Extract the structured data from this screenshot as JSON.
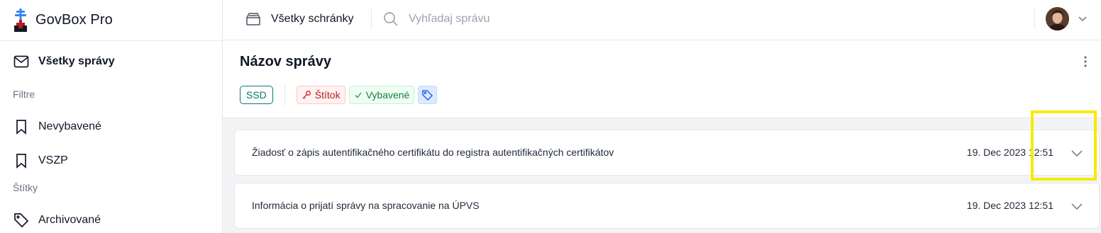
{
  "app": {
    "name": "GovBox Pro"
  },
  "sidebar": {
    "all_messages": "Všetky správy",
    "filters_heading": "Filtre",
    "filters": [
      {
        "label": "Nevybavené",
        "icon": "bookmark-icon"
      },
      {
        "label": "VSZP",
        "icon": "bookmark-icon"
      }
    ],
    "tags_heading": "Štítky",
    "tags": [
      {
        "label": "Archivované",
        "icon": "tag-icon"
      }
    ]
  },
  "header": {
    "mailbox_label": "Všetky schránky",
    "search_placeholder": "Vyhľadaj správu"
  },
  "message": {
    "title": "Názov správy",
    "tags": {
      "ssd": "SSD",
      "stitok": "Štítok",
      "vybavene": "Vybavené"
    },
    "items": [
      {
        "subject": "Žiadosť o zápis autentifikačného certifikátu do registra autentifikačných certifikátov",
        "date": "19. Dec 2023 12:51"
      },
      {
        "subject": "Informácia o prijatí správy na spracovanie na ÚPVS",
        "date": "19. Dec 2023 12:51"
      }
    ]
  },
  "colors": {
    "highlight": "#f5eb00",
    "accent_teal": "#0f766e",
    "tag_red": "#b91c1c",
    "tag_green": "#15803d",
    "tag_blue": "#2563eb"
  }
}
